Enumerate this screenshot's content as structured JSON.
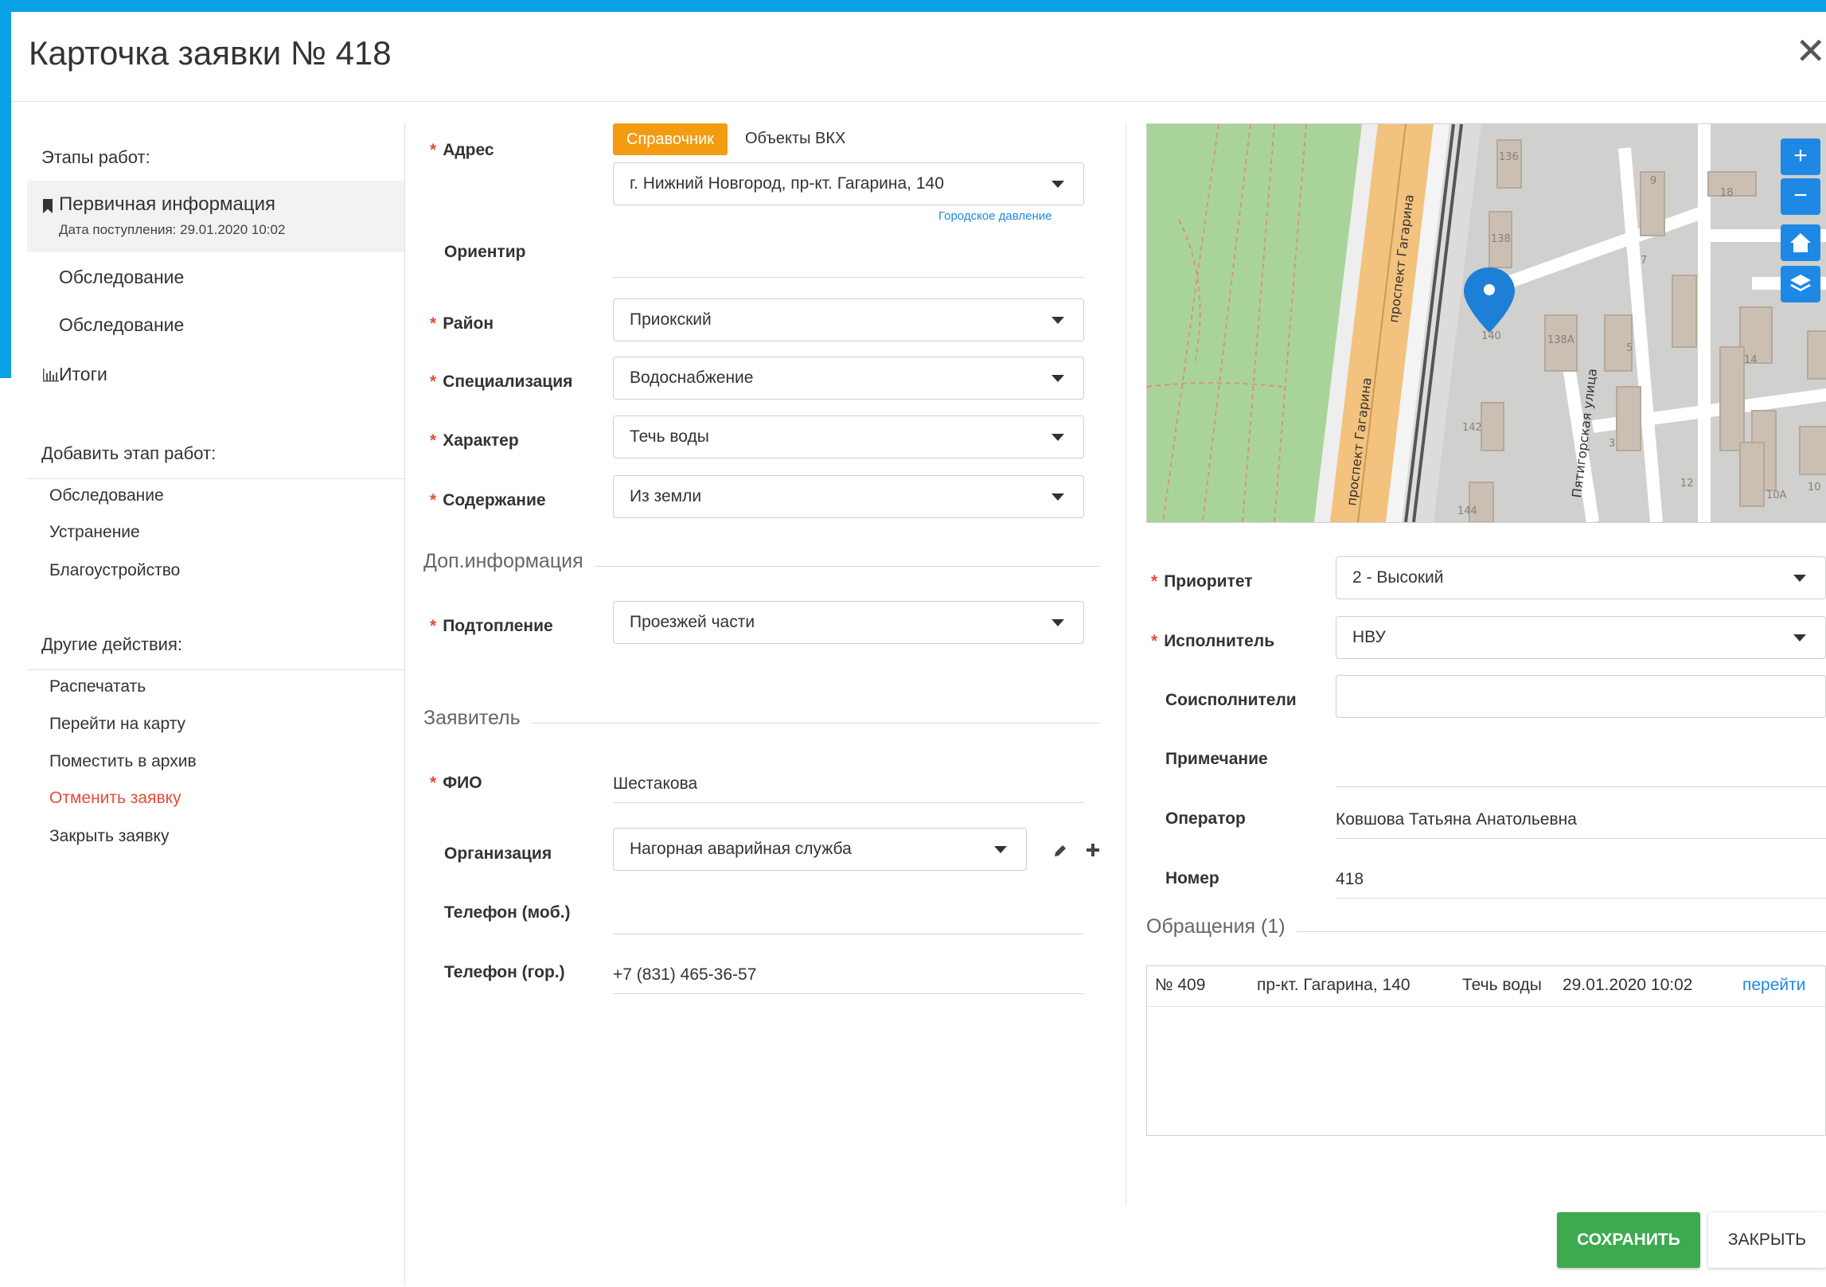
{
  "header": {
    "title": "Карточка заявки № 418"
  },
  "sidebar": {
    "stages_title": "Этапы работ:",
    "stages": [
      {
        "label": "Первичная информация",
        "sub": "Дата поступления: 29.01.2020 10:02"
      },
      {
        "label": "Обследование"
      },
      {
        "label": "Обследование"
      },
      {
        "label": "Итоги"
      }
    ],
    "add_title": "Добавить этап работ:",
    "add_items": [
      "Обследование",
      "Устранение",
      "Благоустройство"
    ],
    "other_title": "Другие действия:",
    "other_items": [
      "Распечатать",
      "Перейти на карту",
      "Поместить в архив",
      "Отменить заявку",
      "Закрыть заявку"
    ]
  },
  "form": {
    "address": {
      "label": "Адрес",
      "tab_active": "Справочник",
      "tab_other": "Объекты ВКХ",
      "value": "г. Нижний Новгород, пр-кт. Гагарина, 140",
      "hint": "Городское давление"
    },
    "landmark": {
      "label": "Ориентир",
      "value": ""
    },
    "district": {
      "label": "Район",
      "value": "Приокский"
    },
    "specialization": {
      "label": "Специализация",
      "value": "Водоснабжение"
    },
    "character": {
      "label": "Характер",
      "value": "Течь воды"
    },
    "content": {
      "label": "Содержание",
      "value": "Из земли"
    },
    "extra_title": "Доп.информация",
    "flooding": {
      "label": "Подтопление",
      "value": "Проезжей части"
    },
    "applicant_title": "Заявитель",
    "fio": {
      "label": "ФИО",
      "value": "Шестакова"
    },
    "organization": {
      "label": "Организация",
      "value": "Нагорная аварийная служба"
    },
    "phone_mob": {
      "label": "Телефон (моб.)",
      "value": ""
    },
    "phone_city": {
      "label": "Телефон (гор.)",
      "value": "+7 (831) 465-36-57"
    }
  },
  "map": {
    "street1": "проспект Гагарина",
    "street2": "проспект Гагарина",
    "street3": "Пятигорская улица",
    "houses": [
      "136",
      "138",
      "140",
      "142",
      "144",
      "138А",
      "9",
      "7",
      "5",
      "3",
      "18",
      "14",
      "12",
      "10А",
      "10"
    ],
    "zoom_in": "+",
    "zoom_out": "−"
  },
  "right": {
    "priority": {
      "label": "Приоритет",
      "value": "2 - Высокий"
    },
    "executor": {
      "label": "Исполнитель",
      "value": "НВУ"
    },
    "coexecutors": {
      "label": "Соисполнители",
      "value": ""
    },
    "note": {
      "label": "Примечание",
      "value": ""
    },
    "operator": {
      "label": "Оператор",
      "value": "Ковшова Татьяна Анатольевна"
    },
    "number": {
      "label": "Номер",
      "value": "418"
    },
    "appeals_title": "Обращения (1)",
    "appeals": [
      {
        "num": "№ 409",
        "address": "пр-кт. Гагарина, 140",
        "type": "Течь воды",
        "date": "29.01.2020 10:02",
        "action": "перейти"
      }
    ]
  },
  "buttons": {
    "save": "СОХРАНИТЬ",
    "close": "ЗАКРЫТЬ"
  },
  "colors": {
    "accent": "#0aa0e6",
    "orange": "#f39c12",
    "save": "#3daa4f",
    "required": "#e74c3c",
    "link": "#1e88e5"
  }
}
